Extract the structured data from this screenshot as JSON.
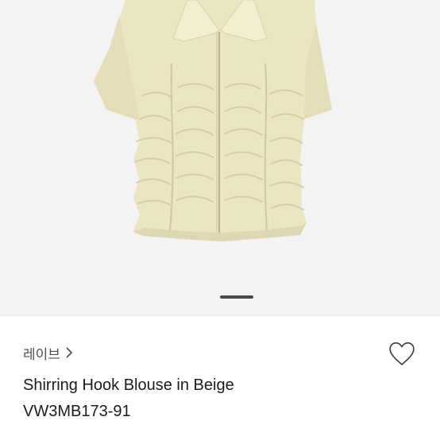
{
  "gallery": {
    "image_alt": "Shirring Hook Blouse in Beige",
    "garment_color": "#ebe6c2",
    "background_color": "#f3f3f3",
    "current_page": 1
  },
  "product": {
    "brand": "레이브",
    "name": "Shirring Hook Blouse in Beige",
    "code": "VW3MB173-91"
  },
  "icons": {
    "brand_chevron": "chevron-right-icon",
    "wishlist": "heart-outline-icon"
  },
  "colors": {
    "text": "#1c1c1c",
    "brand_text": "#4d4d4d",
    "icon_stroke": "#3a3a3a"
  }
}
